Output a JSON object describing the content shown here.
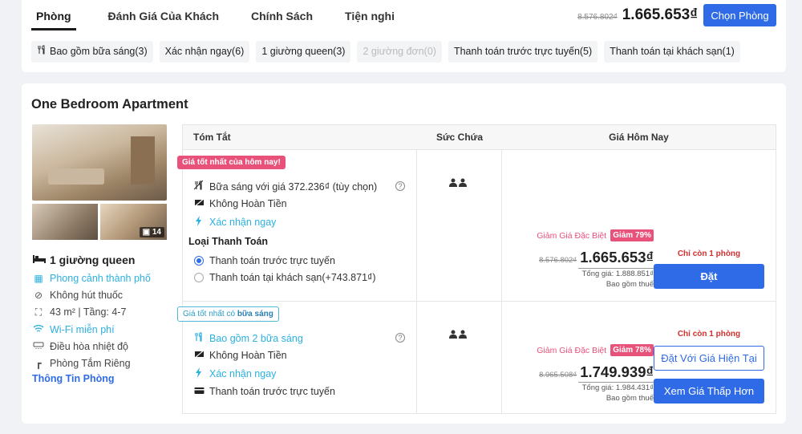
{
  "tabs": [
    "Phòng",
    "Đánh Giá Của Khách",
    "Chính Sách",
    "Tiện nghi"
  ],
  "header": {
    "old_price": "8.576.802₫",
    "price": "1.665.653₫",
    "choose_button": "Chọn Phòng"
  },
  "filters": [
    {
      "label": "Bao gồm bữa sáng(3)",
      "icon": "fork-knife-icon",
      "disabled": false
    },
    {
      "label": "Xác nhận ngay(6)",
      "disabled": false
    },
    {
      "label": "1 giường queen(3)",
      "disabled": false
    },
    {
      "label": "2 giường đơn(0)",
      "disabled": true
    },
    {
      "label": "Thanh toán trước trực tuyến(5)",
      "disabled": false
    },
    {
      "label": "Thanh toán tại khách sạn(1)",
      "disabled": false
    }
  ],
  "room": {
    "title": "One Bedroom Apartment",
    "photo_count": "14",
    "amenities": [
      {
        "label": "1 giường queen",
        "icon": "bed-icon"
      },
      {
        "label": "Phong cảnh thành phố",
        "icon": "city-view-icon"
      },
      {
        "label": "Không hút thuốc",
        "icon": "no-smoking-icon"
      },
      {
        "label": "43 m² | Tầng: 4-7",
        "icon": "area-icon"
      },
      {
        "label": "Wi-Fi miễn phí",
        "icon": "wifi-icon"
      },
      {
        "label": "Điều hòa nhiệt độ",
        "icon": "air-conditioner-icon"
      },
      {
        "label": "Phòng Tắm Riêng",
        "icon": "shower-icon"
      }
    ],
    "info_link": "Thông Tin Phòng"
  },
  "table": {
    "headers": [
      "Tóm Tắt",
      "Sức Chứa",
      "Giá Hôm Nay"
    ],
    "rows": [
      {
        "tag": "Giá tốt nhất của hôm nay!",
        "features": [
          "Bữa sáng với giá 372.236₫ (tùy chọn)",
          "Không Hoàn Tiền",
          "Xác nhận ngay"
        ],
        "payment_label": "Loại Thanh Toán",
        "payment_options": [
          "Thanh toán trước trực tuyến",
          "Thanh toán tại khách sạn(+743.871₫)"
        ],
        "capacity": "👤👤",
        "discount_text": "Giảm Giá Đặc Biệt",
        "discount_badge": "Giảm 79%",
        "old_price": "8.576.802₫",
        "price": "1.665.653₫",
        "total": "Tổng giá: 1.888.851₫",
        "tax_note": "Bao gồm thuế",
        "only_left": "Chỉ còn 1 phòng",
        "book_button": "Đặt"
      },
      {
        "tag_prefix": "Giá tốt nhất có ",
        "tag_bold": "bữa sáng",
        "features": [
          "Bao gồm 2 bữa sáng",
          "Không Hoàn Tiền",
          "Xác nhận ngay",
          "Thanh toán trước trực tuyến"
        ],
        "capacity": "👤👤",
        "discount_text": "Giảm Giá Đặc Biệt",
        "discount_badge": "Giảm 78%",
        "old_price": "8.965.508₫",
        "price": "1.749.939₫",
        "total": "Tổng giá: 1.984.431₫",
        "tax_note": "Bao gồm thuế",
        "only_left": "Chỉ còn 1 phòng",
        "book_current_button": "Đặt Với Giá Hiện Tại",
        "lower_price_button": "Xem Giá Thấp Hơn"
      }
    ]
  },
  "colors": {
    "primary": "#2f6be6",
    "discount": "#e8527a",
    "info": "#2bb0e0",
    "alert": "#d32f2f"
  }
}
